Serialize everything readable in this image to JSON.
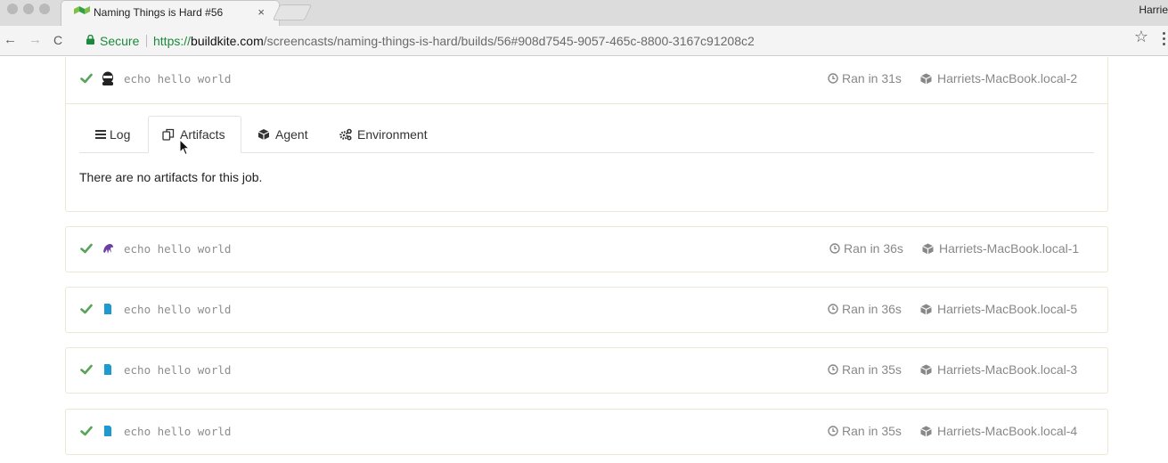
{
  "browser": {
    "tab_title": "Naming Things is Hard #56",
    "tab_close": "×",
    "profile_name": "Harrie",
    "secure_label": "Secure",
    "url_scheme": "https://",
    "url_host": "buildkite.com",
    "url_path": "/screencasts/naming-things-is-hard/builds/56#908d7545-9057-465c-8800-3167c91208c2",
    "back_glyph": "←",
    "forward_glyph": "→",
    "reload_glyph": "C",
    "star_glyph": "☆"
  },
  "colors": {
    "success_green": "#5aa35a",
    "secure_green": "#1a8a3a",
    "card_border": "#ece8d3",
    "agent_teal": "#1d9bd1",
    "agent_purple": "#6b3fa0"
  },
  "expanded_job": {
    "command": "echo hello world",
    "ran": "Ran in 31s",
    "agent": "Harriets-MacBook.local-2",
    "agent_icon": "ninja-avatar-icon",
    "tabs": [
      {
        "label": "Log",
        "icon": "list-icon"
      },
      {
        "label": "Artifacts",
        "icon": "copy-files-icon"
      },
      {
        "label": "Agent",
        "icon": "cube-icon"
      },
      {
        "label": "Environment",
        "icon": "gears-icon"
      }
    ],
    "active_tab": "Artifacts",
    "empty_message": "There are no artifacts for this job."
  },
  "jobs": [
    {
      "command": "echo hello world",
      "ran": "Ran in 36s",
      "agent": "Harriets-MacBook.local-1",
      "agent_icon": "purple-octopus-icon"
    },
    {
      "command": "echo hello world",
      "ran": "Ran in 36s",
      "agent": "Harriets-MacBook.local-5",
      "agent_icon": "blue-tag-icon"
    },
    {
      "command": "echo hello world",
      "ran": "Ran in 35s",
      "agent": "Harriets-MacBook.local-3",
      "agent_icon": "blue-tag-icon"
    },
    {
      "command": "echo hello world",
      "ran": "Ran in 35s",
      "agent": "Harriets-MacBook.local-4",
      "agent_icon": "blue-tag-icon"
    }
  ]
}
